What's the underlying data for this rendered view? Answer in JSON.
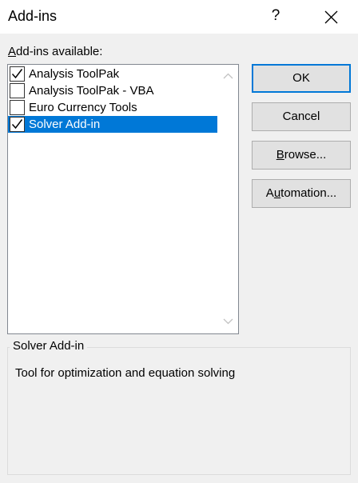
{
  "window": {
    "title": "Add-ins",
    "help_label": "?"
  },
  "list": {
    "label_prefix": "A",
    "label_rest": "dd-ins available:",
    "items": [
      {
        "label": "Analysis ToolPak",
        "checked": true,
        "selected": false
      },
      {
        "label": "Analysis ToolPak - VBA",
        "checked": false,
        "selected": false
      },
      {
        "label": "Euro Currency Tools",
        "checked": false,
        "selected": false
      },
      {
        "label": "Solver Add-in",
        "checked": true,
        "selected": true
      }
    ]
  },
  "buttons": {
    "ok": "OK",
    "cancel": "Cancel",
    "browse_prefix": "B",
    "browse_rest": "rowse...",
    "automation_prefix": "A",
    "automation_mid": "u",
    "automation_rest": "tomation..."
  },
  "description": {
    "title": "Solver Add-in",
    "text": "Tool for optimization and equation solving"
  },
  "colors": {
    "selection": "#0078d7",
    "dialog_bg": "#f0f0f0",
    "button_bg": "#e1e1e1"
  }
}
